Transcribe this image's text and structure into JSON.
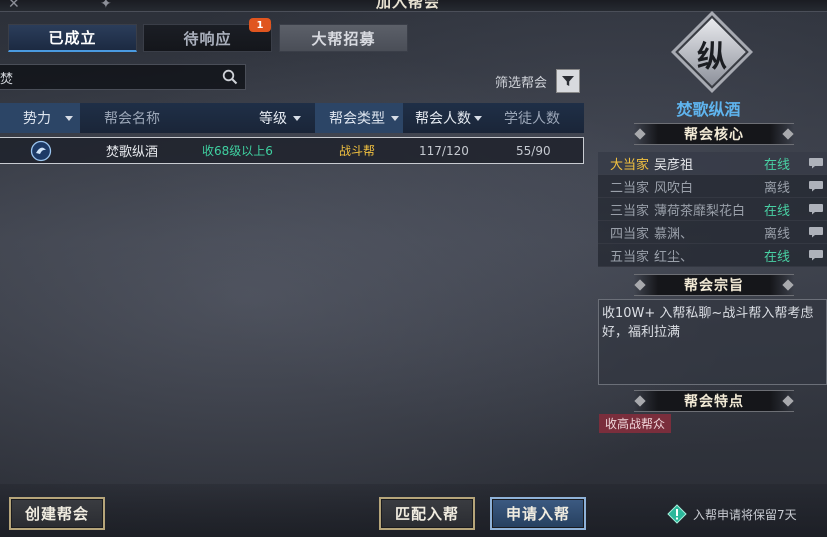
{
  "window": {
    "title": "加入帮会"
  },
  "tabs": [
    {
      "label": "已成立"
    },
    {
      "label": "待响应",
      "badge": "1"
    },
    {
      "label": "大帮招募"
    }
  ],
  "search": {
    "value": "焚"
  },
  "filter": {
    "label": "筛选帮会"
  },
  "table": {
    "columns": [
      "势力",
      "帮会名称",
      "等级",
      "帮会类型",
      "帮会人数",
      "学徒人数"
    ],
    "rows": [
      {
        "name": "焚歌纵酒",
        "level": "收68级以上6",
        "type": "战斗帮",
        "members": "117/120",
        "apprentices": "55/90"
      }
    ]
  },
  "guild": {
    "emblem": "纵",
    "name": "焚歌纵酒",
    "core_title": "帮会核心",
    "core": [
      {
        "role": "大当家",
        "member": "吴彦祖",
        "status": "在线"
      },
      {
        "role": "二当家",
        "member": "风吹白",
        "status": "离线"
      },
      {
        "role": "三当家",
        "member": "薄荷茶靡梨花白",
        "status": "在线"
      },
      {
        "role": "四当家",
        "member": "慕渊、",
        "status": "离线"
      },
      {
        "role": "五当家",
        "member": "红尘、",
        "status": "在线"
      }
    ],
    "purpose_title": "帮会宗旨",
    "purpose": "收10W+ 入帮私聊~战斗帮入帮考虑好，福利拉满",
    "features_title": "帮会特点",
    "features": [
      "收高战帮众"
    ]
  },
  "buttons": {
    "create": "创建帮会",
    "match": "匹配入帮",
    "apply": "申请入帮"
  },
  "note": "入帮申请将保留7天",
  "colors": {
    "accent_blue": "#5fb4ee",
    "online": "#49d1a4",
    "gold": "#f0c040",
    "badge": "#e0551f"
  }
}
